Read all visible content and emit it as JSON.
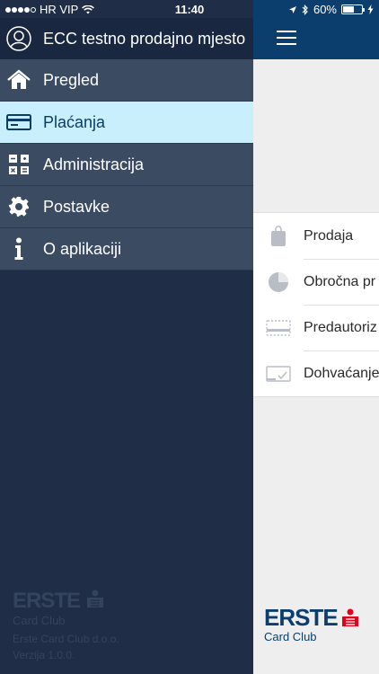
{
  "status_bar": {
    "carrier": "HR VIP",
    "time": "11:40",
    "battery": "60%",
    "battery_level": 0.6
  },
  "drawer": {
    "title": "ECC testno prodajno mjesto",
    "items": [
      {
        "label": "Pregled",
        "icon": "home-icon"
      },
      {
        "label": "Plaćanja",
        "icon": "credit-card-icon",
        "active": true
      },
      {
        "label": "Administracija",
        "icon": "grid-icon"
      },
      {
        "label": "Postavke",
        "icon": "gear-icon"
      },
      {
        "label": "O aplikaciji",
        "icon": "info-icon"
      }
    ],
    "footer": {
      "logo_word": "ERSTE",
      "logo_sub": "Card Club",
      "company": "Erste Card Club d.o.o.",
      "version": "Verzija 1.0.0."
    }
  },
  "main": {
    "list": [
      {
        "label": "Prodaja",
        "icon": "shopping-bag-icon"
      },
      {
        "label": "Obročna pr",
        "icon": "pie-chart-icon"
      },
      {
        "label": "Predautoriz",
        "icon": "card-dashed-icon"
      },
      {
        "label": "Dohvaćanje",
        "icon": "card-check-icon"
      }
    ],
    "brand": {
      "word": "ERSTE",
      "sub": "Card Club"
    }
  },
  "colors": {
    "drawer_bg": "#1f2d46",
    "menu_item_bg": "#3b4b62",
    "active_bg": "#c9eefc",
    "topbar_blue": "#0c3e6d",
    "erste_red": "#e2001a"
  }
}
